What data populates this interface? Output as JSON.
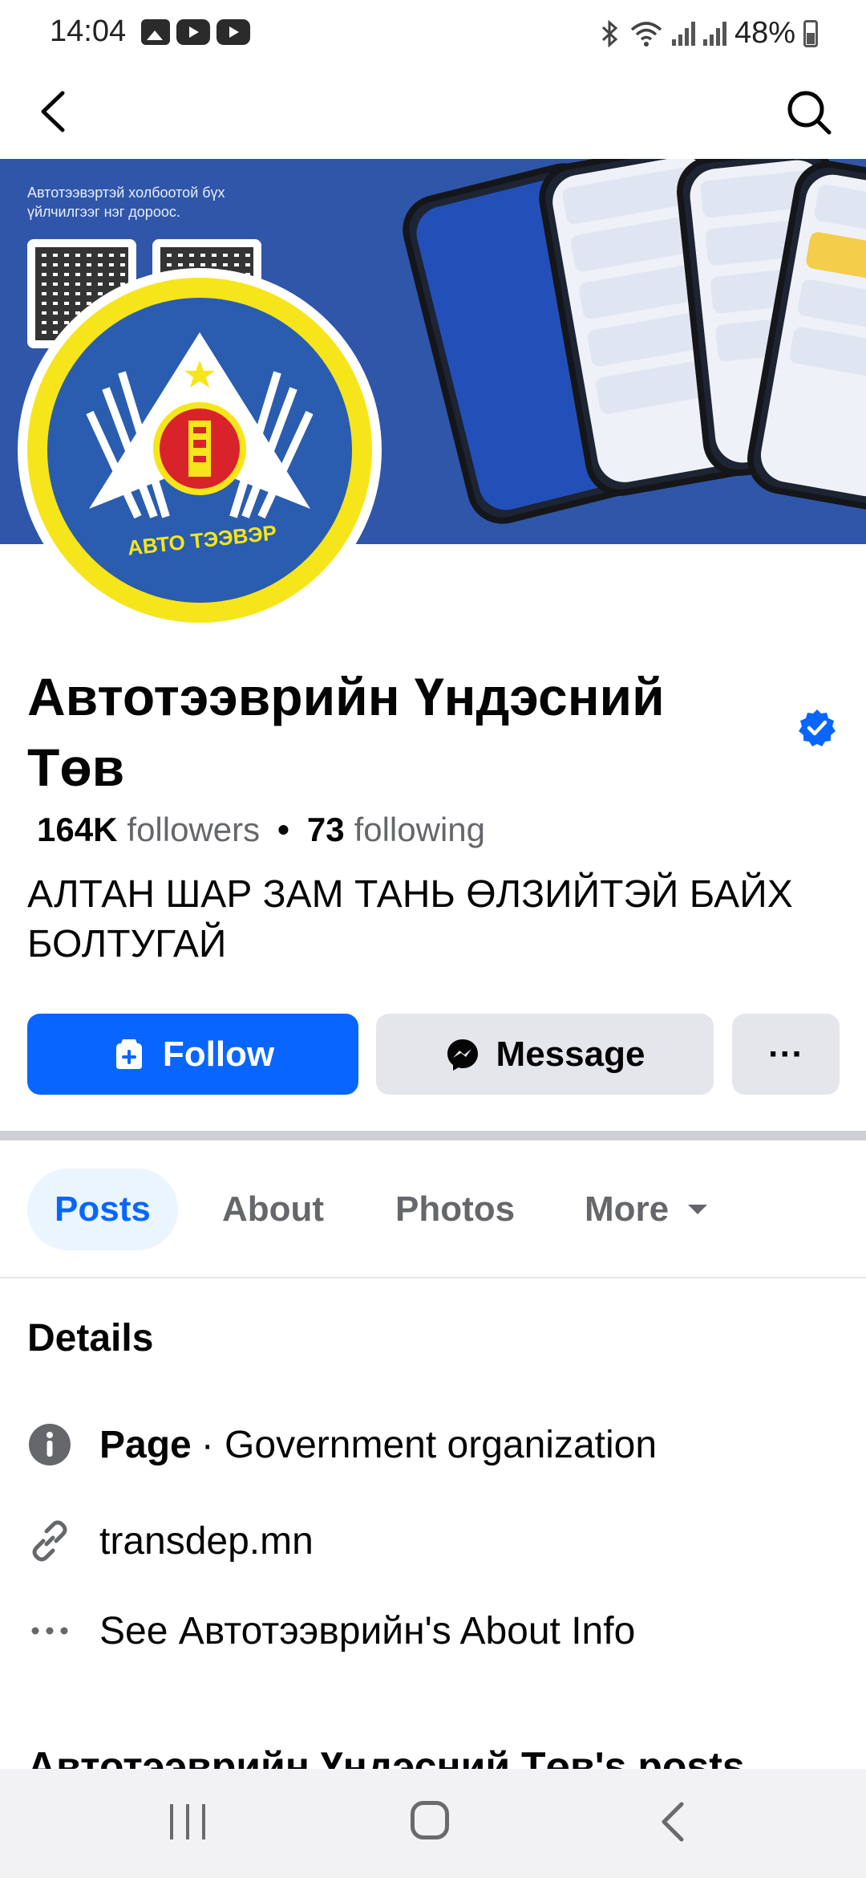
{
  "status_bar": {
    "time": "14:04",
    "battery": "48%"
  },
  "nav": {
    "back_icon": "chevron-left-icon",
    "search_icon": "search-icon"
  },
  "cover": {
    "tagline": "Автотээвэртэй холбоотой бүх үйлчилгээг нэг дороос."
  },
  "avatar": {
    "logo_text": "АВТО ТЭЭВЭР"
  },
  "page": {
    "name": "Автотээврийн Үндэсний Төв",
    "verified_icon": "verified-badge-icon",
    "followers_count": "164K",
    "followers_label": "followers",
    "following_count": "73",
    "following_label": "following",
    "bio": "АЛТАН ШАР ЗАМ ТАНЬ ӨЛЗИЙТЭЙ БАЙХ БОЛТУГАЙ"
  },
  "actions": {
    "follow_label": "Follow",
    "message_label": "Message",
    "more_label": "···"
  },
  "tabs": [
    {
      "label": "Posts",
      "active": true
    },
    {
      "label": "About",
      "active": false
    },
    {
      "label": "Photos",
      "active": false
    },
    {
      "label": "More",
      "active": false
    }
  ],
  "details": {
    "title": "Details",
    "category_prefix": "Page",
    "category": " · Government organization",
    "website": "transdep.mn",
    "about_link": "See Автотээврийн's About Info"
  },
  "posts_heading": "Автотээврийн Үндэсний Төв's posts",
  "colors": {
    "primary": "#0866ff",
    "secondary_btn": "#e4e6eb",
    "active_tab_bg": "#ebf5ff",
    "logo_blue": "#2a5db0",
    "logo_yellow": "#f6e51b"
  }
}
